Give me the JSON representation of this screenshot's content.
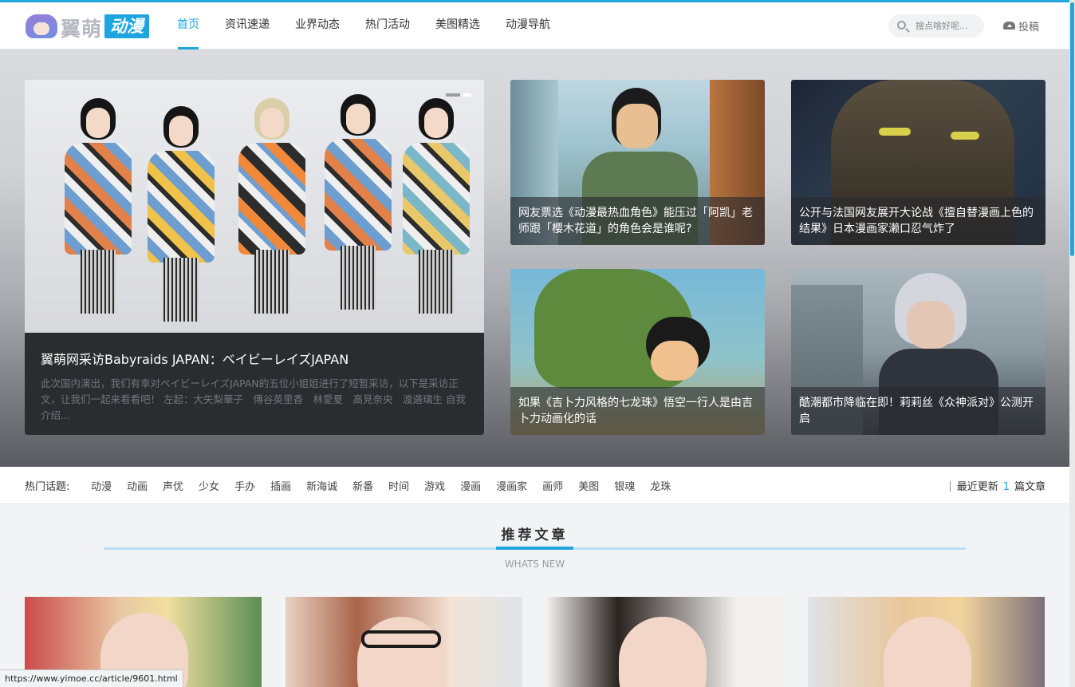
{
  "logo": {
    "text_main": "翼萌",
    "text_badge": "动漫"
  },
  "nav": {
    "items": [
      {
        "label": "首页",
        "active": true
      },
      {
        "label": "资讯速递"
      },
      {
        "label": "业界动态"
      },
      {
        "label": "热门活动"
      },
      {
        "label": "美图精选"
      },
      {
        "label": "动漫导航"
      }
    ]
  },
  "search": {
    "placeholder": "搜点啥好呢..."
  },
  "submit_label": "投稿",
  "featured": {
    "title": "翼萌网采访Babyraids JAPAN：ベイビーレイズJAPAN",
    "excerpt": "此次国内演出，我们有幸对ベイビーレイズJAPAN的五位小姐姐进行了短暂采访，以下是采访正文，让我们一起来看看吧！ 左起：大矢梨華子　傳谷英里香　林愛夏　高見奈央　渡邉璃生 自我介绍..."
  },
  "side_cards": [
    {
      "caption": "网友票选《动漫最热血角色》能压过「阿凯」老师跟「樱木花道」的角色会是谁呢?"
    },
    {
      "caption": "公开与法国网友展开大论战《擅自替漫画上色的结果》日本漫画家濑口忍气炸了"
    },
    {
      "caption": "如果《吉卜力风格的七龙珠》悟空一行人是由吉卜力动画化的话"
    },
    {
      "caption": "酷潮都市降临在即！莉莉丝《众神派对》公测开启"
    }
  ],
  "topics": {
    "label": "热门话题:",
    "items": [
      "动漫",
      "动画",
      "声优",
      "少女",
      "手办",
      "插画",
      "新海诚",
      "新番",
      "时间",
      "游戏",
      "漫画",
      "漫画家",
      "画师",
      "美图",
      "银魂",
      "龙珠"
    ],
    "recent_prefix": "最近更新",
    "recent_count": "1",
    "recent_suffix": "篇文章"
  },
  "section": {
    "title": "推荐文章",
    "subtitle": "WHATS NEW"
  },
  "status_url": "https://www.yimoe.cc/article/9601.html",
  "colors": {
    "accent": "#1ea5e0",
    "header_bg": "#ffffff",
    "caption_bg": "#2b2c30"
  }
}
